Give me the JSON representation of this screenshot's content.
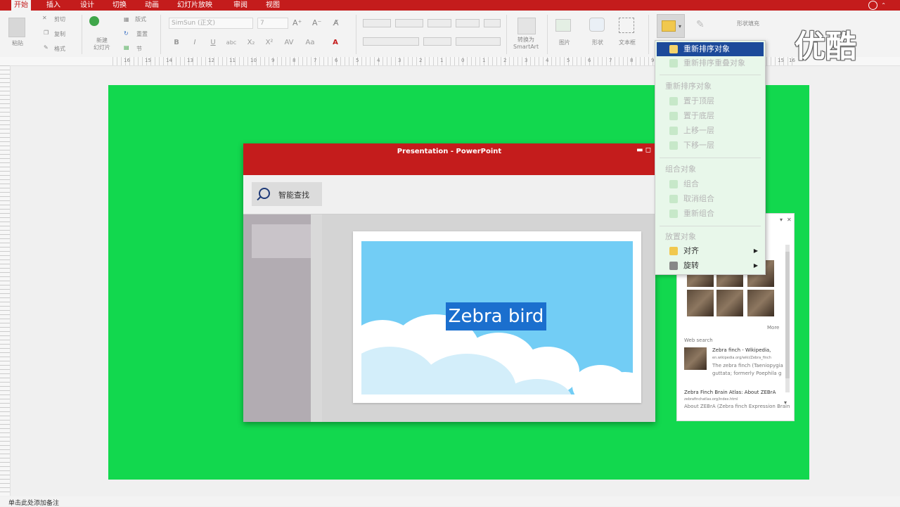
{
  "tabs": [
    "开始",
    "插入",
    "设计",
    "切换",
    "动画",
    "幻灯片放映",
    "审阅",
    "视图"
  ],
  "ribbon": {
    "paste": "粘贴",
    "cut": "剪切",
    "copy": "复制",
    "format": "格式",
    "new_slide": "新建\n幻灯片",
    "layout": "版式",
    "reset": "重置",
    "section": "节",
    "font_name": "SimSun (正文)",
    "font_size": "7",
    "convert_smartart": "转换为\nSmartArt",
    "picture": "图片",
    "shape": "形状",
    "textbox": "文本框",
    "shape_fill": "形状填充"
  },
  "ruler_labels": [
    "16",
    "15",
    "14",
    "13",
    "12",
    "11",
    "10",
    "9",
    "8",
    "7",
    "6",
    "5",
    "4",
    "3",
    "2",
    "1",
    "0",
    "1",
    "2",
    "3",
    "4",
    "5",
    "6",
    "7",
    "8",
    "9",
    "10",
    "11",
    "12",
    "13",
    "14",
    "15",
    "16"
  ],
  "inner": {
    "title": "Presentation - PowerPoint",
    "smart_lookup": "智能查找",
    "slide_title": "Zebra bird"
  },
  "pane": {
    "more": "More",
    "web_search": "Web search",
    "result1_title": "Zebra finch - Wikipedia,",
    "result1_url": "en.wikipedia.org/wiki/Zebra_finch",
    "result1_snip1": "The zebra finch (Taeniopygia",
    "result1_snip2": "guttata; formerly Poephila g",
    "result2_title": "Zebra Finch Brain Atlas: About ZEBrA",
    "result2_url": "zebrafinchatlas.org/index.html",
    "result2_snip": "About ZEBrA (Zebra finch Expression Brain"
  },
  "dropdown": {
    "item_reorder": "重新排序对象",
    "item_reorder_overlap": "重新排序重叠对象",
    "head_reorder": "重新排序对象",
    "bring_front": "置于顶层",
    "send_back": "置于底层",
    "bring_forward": "上移一层",
    "send_backward": "下移一层",
    "head_group": "组合对象",
    "group": "组合",
    "ungroup": "取消组合",
    "regroup": "重新组合",
    "head_position": "放置对象",
    "align": "对齐",
    "rotate": "旋转",
    "arrow": "▶"
  },
  "status": "单击此处添加备注",
  "watermark": "优酷",
  "colors": {
    "accent_red": "#c41c1c",
    "slide_green": "#12d84e",
    "menu_green": "#e8f7ea",
    "select_blue": "#1c4a9a"
  }
}
